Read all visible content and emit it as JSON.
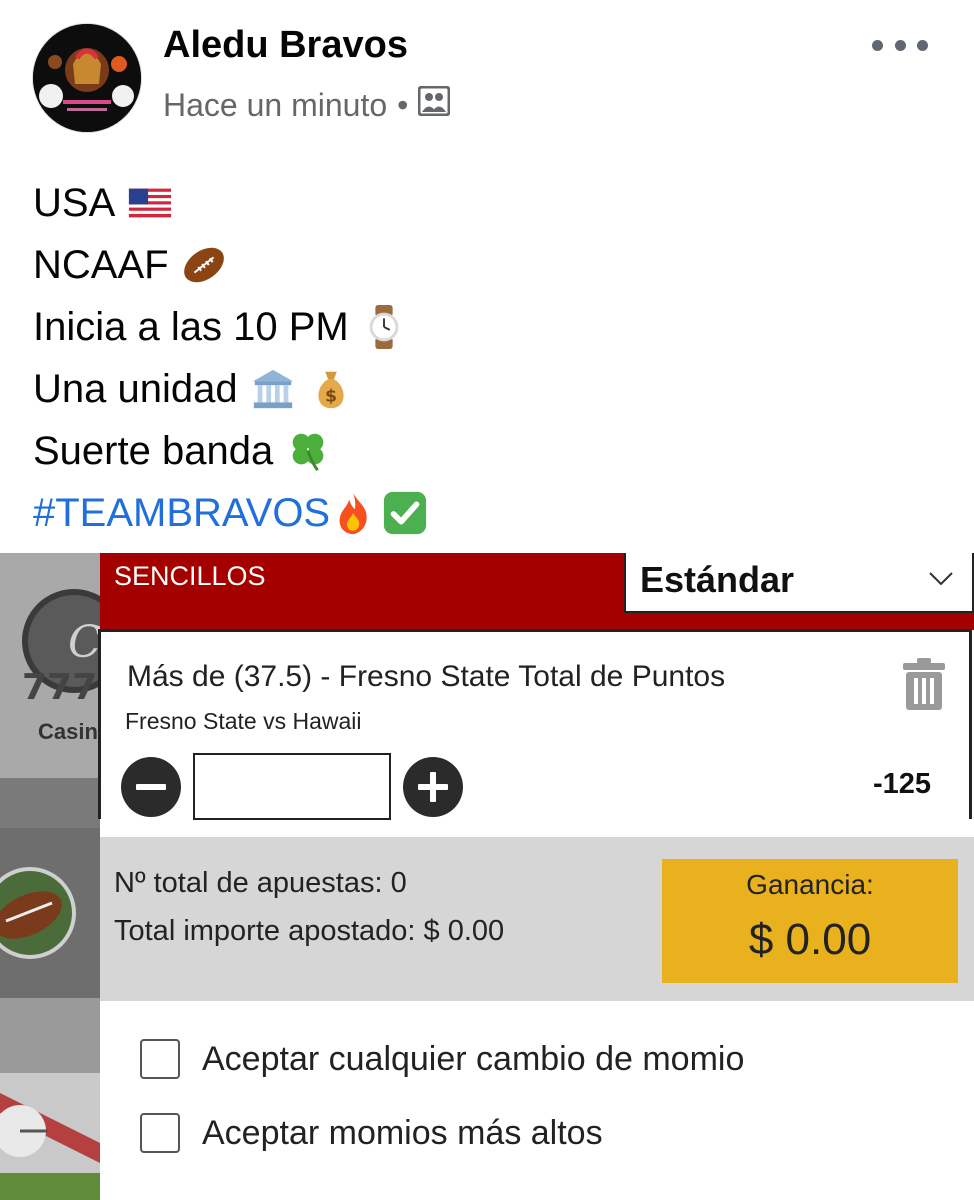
{
  "post": {
    "author": "Aledu Bravos",
    "time": "Hace un minuto",
    "separator": "•",
    "audience_icon": "friends-icon",
    "lines": [
      {
        "text": "USA",
        "emoji": "flag-usa"
      },
      {
        "text": "NCAAF",
        "emoji": "american-football"
      },
      {
        "text": "Inicia a las 10 PM",
        "emoji": "watch"
      },
      {
        "text": "Una unidad",
        "emoji": "bank, money-bag"
      },
      {
        "text": "Suerte banda",
        "emoji": "four-leaf-clover"
      },
      {
        "text": "#TEAMBRAVOS",
        "emoji": "fire, check-mark"
      }
    ],
    "hashtag_color": "#216fdb"
  },
  "betslip": {
    "tab_label": "SENCILLOS",
    "bet_type_select": "Estándar",
    "header_color": "#a40000",
    "casino_label": "Casin",
    "selection": {
      "title": "Más de (37.5) - Fresno State Total de Puntos",
      "match": "Fresno State vs Hawaii",
      "odds": "-125",
      "stake": ""
    },
    "summary": {
      "total_bets": "Nº total de apuestas: 0",
      "total_staked": "Total importe apostado: $ 0.00",
      "win_label": "Ganancia:",
      "win_value": "$ 0.00",
      "win_color": "#e8b11d"
    },
    "options": {
      "accept_any": "Aceptar cualquier cambio de momio",
      "accept_higher": "Aceptar momios más altos"
    }
  }
}
